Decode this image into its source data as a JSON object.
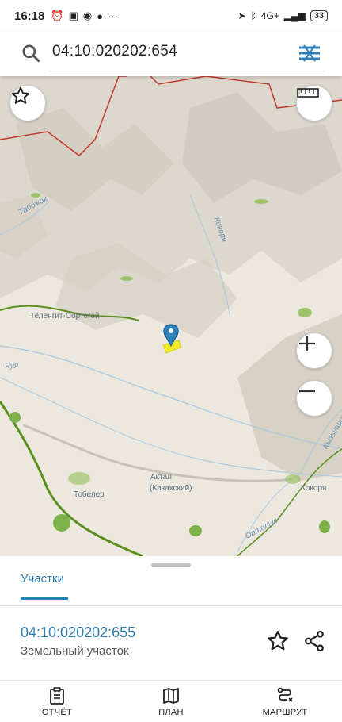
{
  "status_bar": {
    "time": "16:18",
    "network": "4G+",
    "battery": "33"
  },
  "search": {
    "query": "04:10:020202:654",
    "icon": "search-icon",
    "menu_icon": "menu-icon"
  },
  "map": {
    "labels": {
      "tabozhok": "Табожок",
      "kokorya_river": "Кокоря",
      "telengit": "Теленгит-Сортогой",
      "chuya": "Чуя",
      "kyzylshin": "Кызылшин",
      "tobeler": "Тобелер",
      "aktal": "Актал",
      "aktal_sub": "(Казахский)",
      "kokorya": "Кокоря",
      "ortolyk": "Ортолык"
    },
    "buttons": {
      "favorite": "star-icon",
      "ruler": "ruler-icon",
      "zoom_in": "+",
      "zoom_out": "−"
    },
    "colors": {
      "marker": "#2c7fb8",
      "parcel": "#f3ea2a",
      "border": "#c0392b",
      "road": "#5a8f1e"
    }
  },
  "sheet": {
    "tab": "Участки",
    "parcel": {
      "number": "04:10:020202:655",
      "type": "Земельный участок"
    }
  },
  "nav": {
    "report": "ОТЧЁТ",
    "plan": "ПЛАН",
    "route": "МАРШРУТ"
  }
}
